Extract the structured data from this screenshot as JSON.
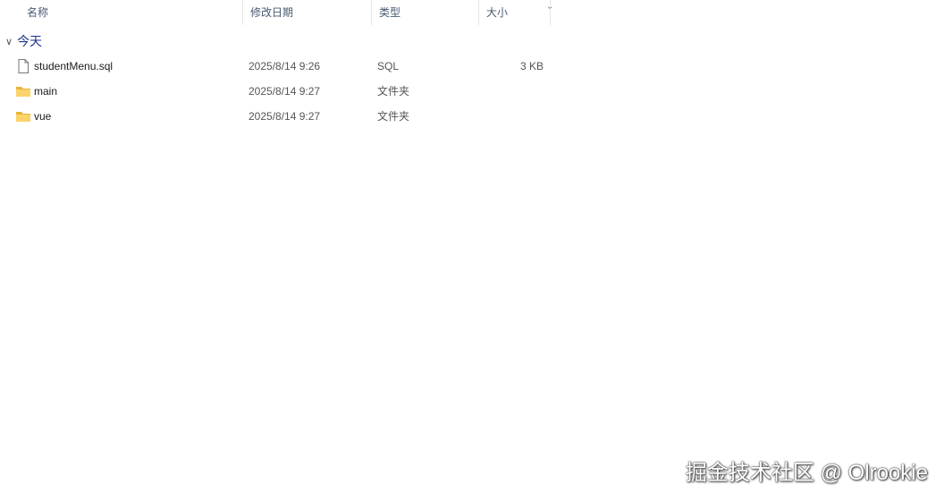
{
  "columns": {
    "name": "名称",
    "date": "修改日期",
    "type": "类型",
    "size": "大小"
  },
  "group": {
    "label": "今天"
  },
  "files": [
    {
      "name": "studentMenu.sql",
      "date": "2025/8/14 9:26",
      "type": "SQL",
      "size": "3 KB",
      "icon": "file-icon"
    },
    {
      "name": "main",
      "date": "2025/8/14 9:27",
      "type": "文件夹",
      "size": "",
      "icon": "folder-icon"
    },
    {
      "name": "vue",
      "date": "2025/8/14 9:27",
      "type": "文件夹",
      "size": "",
      "icon": "folder-icon"
    }
  ],
  "watermark": "掘金技术社区 @ Olrookie"
}
